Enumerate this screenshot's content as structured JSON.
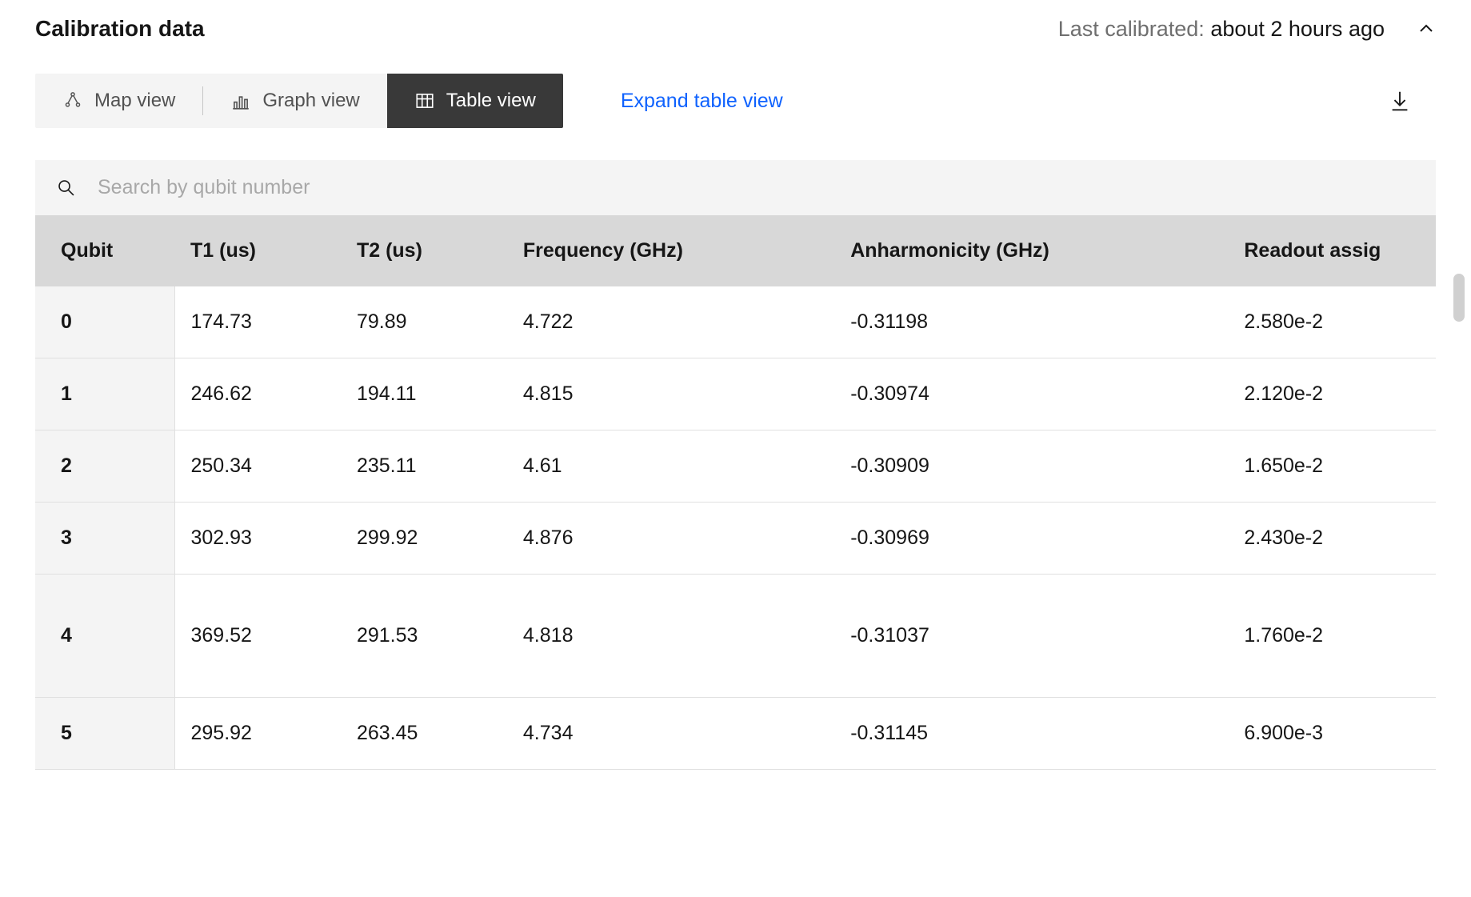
{
  "header": {
    "title": "Calibration data",
    "last_calibrated_label": "Last calibrated: ",
    "last_calibrated_value": "about 2 hours ago"
  },
  "tabs": {
    "map": "Map view",
    "graph": "Graph view",
    "table": "Table view"
  },
  "expand_link": "Expand table view",
  "search": {
    "placeholder": "Search by qubit number"
  },
  "columns": {
    "qubit": "Qubit",
    "t1": "T1 (us)",
    "t2": "T2 (us)",
    "frequency": "Frequency (GHz)",
    "anharmonicity": "Anharmonicity (GHz)",
    "readout": "Readout assig"
  },
  "rows": [
    {
      "qubit": "0",
      "t1": "174.73",
      "t2": "79.89",
      "freq": "4.722",
      "anh": "-0.31198",
      "ro": "2.580e-2"
    },
    {
      "qubit": "1",
      "t1": "246.62",
      "t2": "194.11",
      "freq": "4.815",
      "anh": "-0.30974",
      "ro": "2.120e-2"
    },
    {
      "qubit": "2",
      "t1": "250.34",
      "t2": "235.11",
      "freq": "4.61",
      "anh": "-0.30909",
      "ro": "1.650e-2"
    },
    {
      "qubit": "3",
      "t1": "302.93",
      "t2": "299.92",
      "freq": "4.876",
      "anh": "-0.30969",
      "ro": "2.430e-2"
    },
    {
      "qubit": "4",
      "t1": "369.52",
      "t2": "291.53",
      "freq": "4.818",
      "anh": "-0.31037",
      "ro": "1.760e-2"
    },
    {
      "qubit": "5",
      "t1": "295.92",
      "t2": "263.45",
      "freq": "4.734",
      "anh": "-0.31145",
      "ro": "6.900e-3"
    }
  ]
}
